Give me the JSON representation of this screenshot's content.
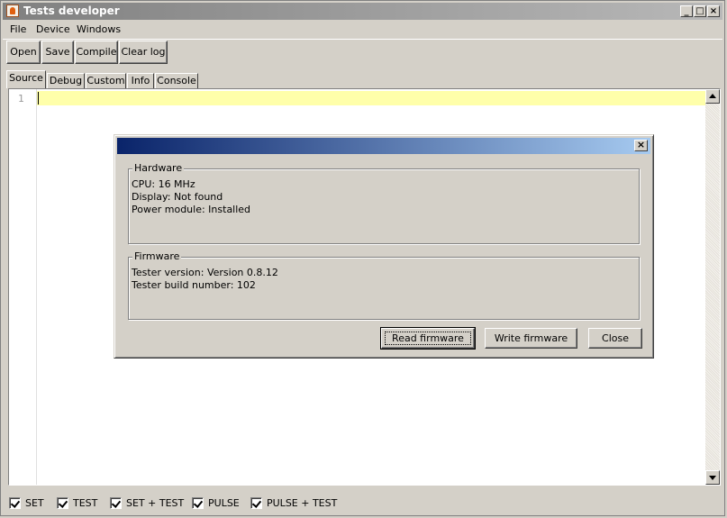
{
  "window": {
    "title": "Tests developer"
  },
  "titlebar_buttons": {
    "minimize": "_",
    "maximize": "□",
    "close": "×"
  },
  "menu": [
    "File",
    "Device",
    "Windows"
  ],
  "toolbar": {
    "open": "Open",
    "save": "Save",
    "compile": "Compile",
    "clear_log": "Clear log"
  },
  "tabs": [
    "Source",
    "Debug",
    "Custom",
    "Info",
    "Console"
  ],
  "active_tab": "Source",
  "editor": {
    "line_number": "1"
  },
  "dialog": {
    "close_glyph": "×",
    "hardware": {
      "legend": "Hardware",
      "lines": [
        "CPU: 16 MHz",
        "Display: Not found",
        "Power module: Installed"
      ]
    },
    "firmware": {
      "legend": "Firmware",
      "lines": [
        "Tester version: Version 0.8.12",
        "Tester build number: 102"
      ]
    },
    "buttons": {
      "read": "Read firmware",
      "write": "Write firmware",
      "close": "Close"
    }
  },
  "status_checkboxes": [
    {
      "label": "SET",
      "checked": true
    },
    {
      "label": "TEST",
      "checked": true
    },
    {
      "label": "SET + TEST",
      "checked": true
    },
    {
      "label": "PULSE",
      "checked": true
    },
    {
      "label": "PULSE + TEST",
      "checked": true
    }
  ],
  "colors": {
    "dialog_title_start": "#0a246a",
    "dialog_title_end": "#a6caf0",
    "current_line": "#ffffaa"
  }
}
